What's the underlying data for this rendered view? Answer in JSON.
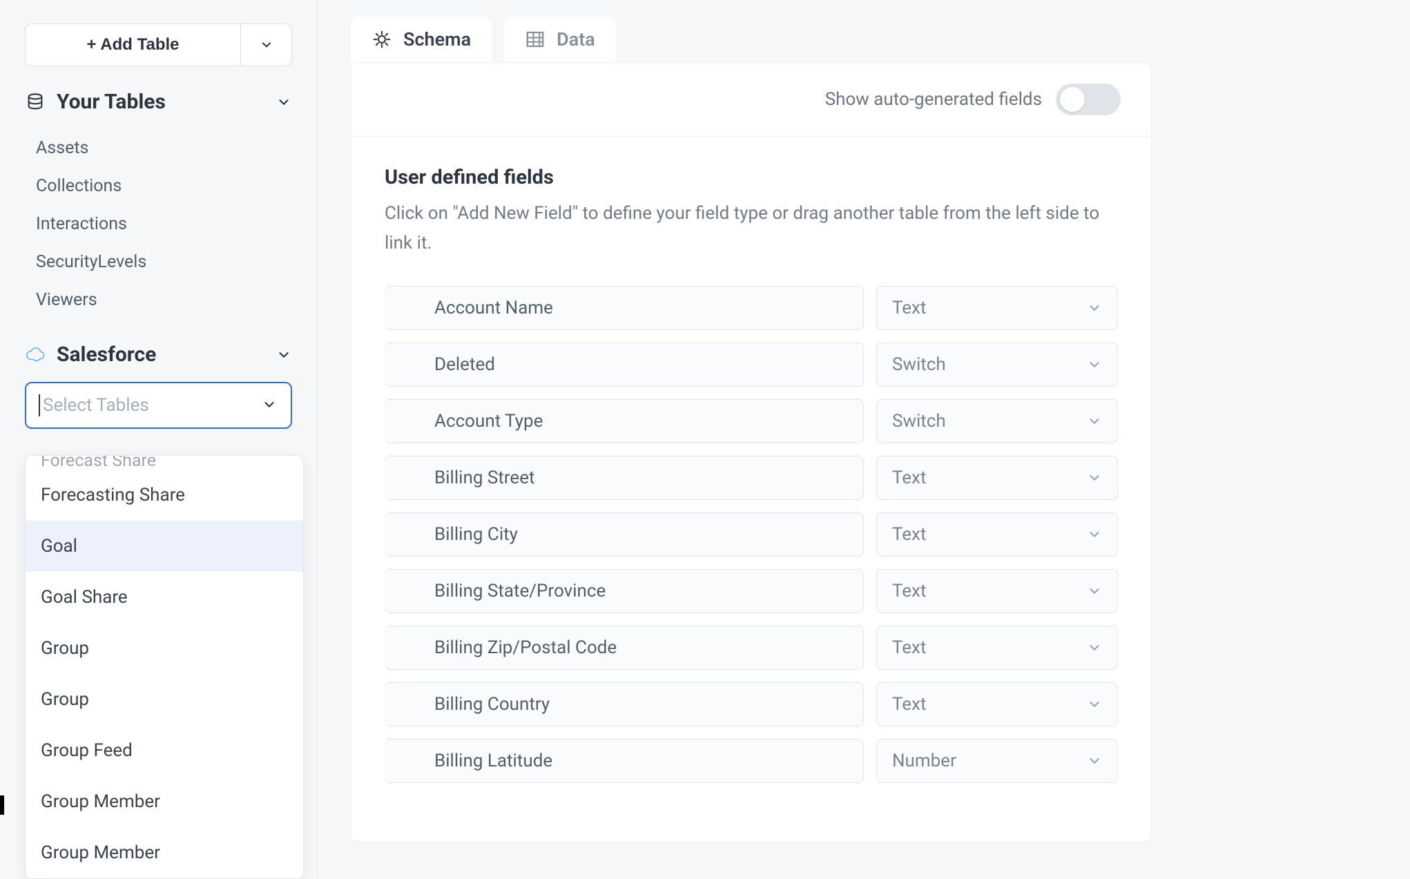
{
  "sidebar": {
    "add_table_label": "+ Add Table",
    "your_tables_label": "Your Tables",
    "your_tables_items": [
      "Assets",
      "Collections",
      "Interactions",
      "SecurityLevels",
      "Viewers"
    ],
    "salesforce_label": "Salesforce",
    "select_placeholder": "Select Tables",
    "dropdown_partial": "Forecast Share",
    "dropdown_items": [
      {
        "label": "Forecasting Share",
        "highlight": false
      },
      {
        "label": "Goal",
        "highlight": true
      },
      {
        "label": "Goal Share",
        "highlight": false
      },
      {
        "label": "Group",
        "highlight": false
      },
      {
        "label": "Group",
        "highlight": false
      },
      {
        "label": "Group Feed",
        "highlight": false
      },
      {
        "label": "Group Member",
        "highlight": false
      },
      {
        "label": "Group Member",
        "highlight": false
      }
    ]
  },
  "tabs": {
    "schema": "Schema",
    "data": "Data"
  },
  "toggle_label": "Show auto-generated fields",
  "fields_section": {
    "title": "User defined fields",
    "description": "Click on \"Add New Field\" to define your field type or drag another table from the left side to link it."
  },
  "fields": [
    {
      "name": "Account Name",
      "type": "Text"
    },
    {
      "name": "Deleted",
      "type": "Switch"
    },
    {
      "name": "Account Type",
      "type": "Switch"
    },
    {
      "name": "Billing Street",
      "type": "Text"
    },
    {
      "name": "Billing City",
      "type": "Text"
    },
    {
      "name": "Billing State/Province",
      "type": "Text"
    },
    {
      "name": "Billing Zip/Postal Code",
      "type": "Text"
    },
    {
      "name": "Billing Country",
      "type": "Text"
    },
    {
      "name": "Billing Latitude",
      "type": "Number"
    }
  ]
}
